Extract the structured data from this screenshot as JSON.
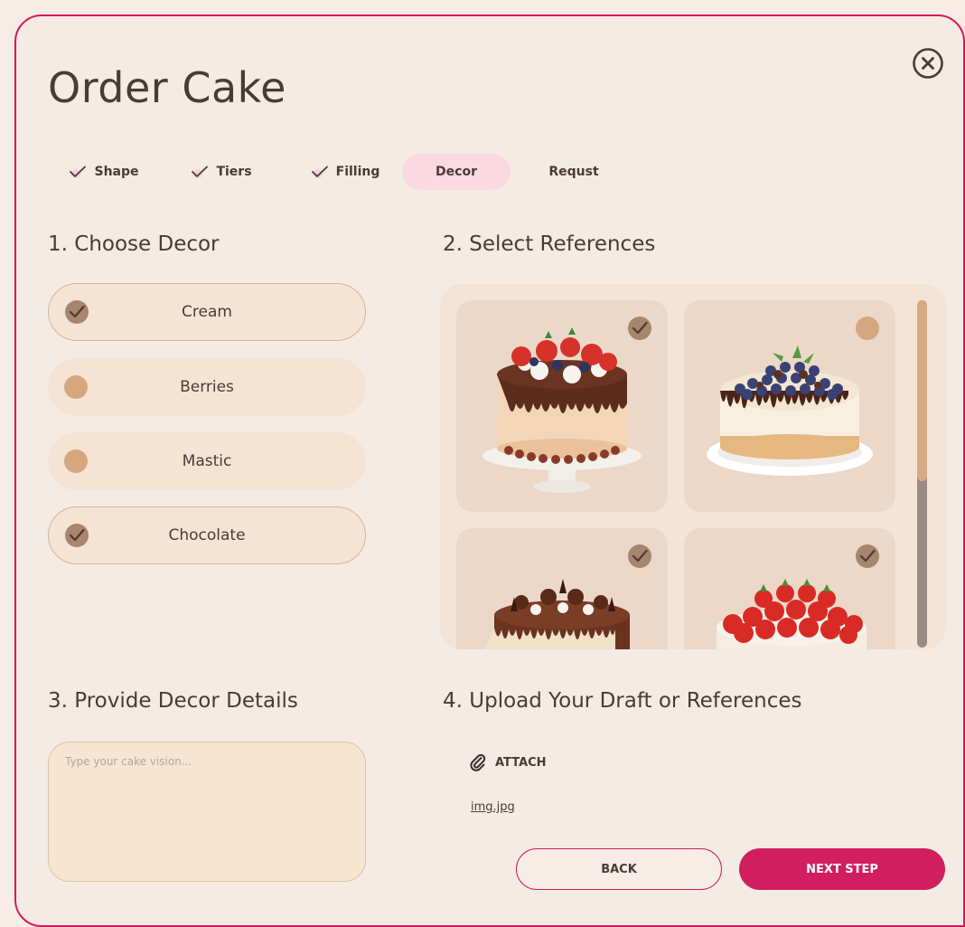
{
  "title": "Order Cake",
  "steps": [
    {
      "label": "Shape",
      "done": true
    },
    {
      "label": "Tiers",
      "done": true
    },
    {
      "label": "Filling",
      "done": true
    },
    {
      "label": "Decor",
      "active": true
    },
    {
      "label": "Requst"
    }
  ],
  "sections": {
    "decor": "1. Choose Decor",
    "references": "2. Select References",
    "details": "3. Provide Decor Details",
    "upload": "4. Upload Your Draft or References"
  },
  "decor_options": [
    {
      "label": "Cream",
      "selected": true
    },
    {
      "label": "Berries",
      "selected": false
    },
    {
      "label": "Mastic",
      "selected": false
    },
    {
      "label": "Chocolate",
      "selected": true
    }
  ],
  "references": [
    {
      "name": "strawberry-chocolate-drip-cake",
      "selected": true
    },
    {
      "name": "blueberry-cheesecake",
      "selected": false
    },
    {
      "name": "chocolate-decorated-cake",
      "selected": true
    },
    {
      "name": "strawberry-cake",
      "selected": true
    }
  ],
  "details": {
    "placeholder": "Type your cake vision..."
  },
  "upload": {
    "attach_label": "ATTACH",
    "file_name": "img.jpg"
  },
  "buttons": {
    "back": "BACK",
    "next": "NEXT STEP"
  },
  "colors": {
    "accent": "#d6195f",
    "background": "#f3ebe4",
    "option_bg": "#f5e4d4",
    "radio_unselected": "#d4a77e",
    "radio_selected": "#a6866c",
    "active_step_bg": "#fbd9e3"
  },
  "icons": {
    "close": "close-circle-icon",
    "check": "checkmark-icon",
    "attach": "paperclip-icon"
  }
}
